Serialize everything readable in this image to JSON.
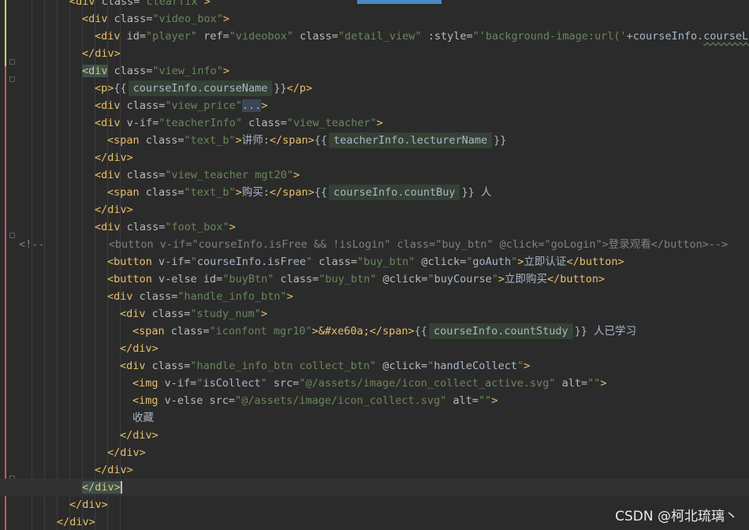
{
  "colors": {
    "background": "#2b2b2b",
    "tag": "#e8bf6a",
    "attribute": "#bababa",
    "string": "#6a8759",
    "text": "#a9b7c6",
    "comment": "#808080",
    "inlay_hint": "#344134"
  },
  "editor": {
    "lines": [
      {
        "tokens": [
          {
            "t": "tag",
            "v": "<div"
          },
          {
            "t": "attr",
            "v": " class="
          },
          {
            "t": "str",
            "v": "\"clearfix\""
          },
          {
            "t": "tag",
            "v": ">"
          }
        ]
      },
      {
        "tokens": [
          {
            "t": "tag",
            "v": "<div"
          },
          {
            "t": "attr",
            "v": " class="
          },
          {
            "t": "str",
            "v": "\"video_box\""
          },
          {
            "t": "tag",
            "v": ">"
          }
        ]
      },
      {
        "tokens": [
          {
            "t": "tag",
            "v": "<div"
          },
          {
            "t": "attr",
            "v": " id="
          },
          {
            "t": "str",
            "v": "\"player\""
          },
          {
            "t": "attr",
            "v": " ref="
          },
          {
            "t": "str",
            "v": "\"videobox\""
          },
          {
            "t": "attr",
            "v": " class="
          },
          {
            "t": "str",
            "v": "\"detail_view\""
          },
          {
            "t": "attr",
            "v": " :style="
          },
          {
            "t": "str",
            "v": "\"'background-image:url('"
          },
          {
            "t": "ex",
            "v": "+courseInfo."
          },
          {
            "t": "ex",
            "v": "courseLogo"
          }
        ]
      },
      {
        "tokens": [
          {
            "t": "tag",
            "v": "</div>"
          }
        ]
      },
      {
        "tokens": [
          {
            "t": "br",
            "v": "<div"
          },
          {
            "t": "attr",
            "v": " class="
          },
          {
            "t": "str",
            "v": "\"view_info\""
          },
          {
            "t": "tag",
            "v": ">"
          }
        ]
      },
      {
        "tokens": [
          {
            "t": "tag",
            "v": "<p>"
          },
          {
            "t": "txt",
            "v": "{{"
          },
          {
            "t": "chip",
            "v": "courseInfo.courseName"
          },
          {
            "t": "txt",
            "v": "}}"
          },
          {
            "t": "tag",
            "v": "</p>"
          }
        ]
      },
      {
        "tokens": [
          {
            "t": "tag",
            "v": "<div"
          },
          {
            "t": "attr",
            "v": " class="
          },
          {
            "t": "str",
            "v": "\"view_price\""
          },
          {
            "t": "folded",
            "v": "..."
          },
          {
            "t": "tag",
            "v": ">"
          }
        ]
      },
      {
        "tokens": [
          {
            "t": "tag",
            "v": "<div"
          },
          {
            "t": "attr",
            "v": " v-if="
          },
          {
            "t": "str",
            "v": "\"teacherInfo\""
          },
          {
            "t": "attr",
            "v": " class="
          },
          {
            "t": "str",
            "v": "\"view_teacher\""
          },
          {
            "t": "tag",
            "v": ">"
          }
        ]
      },
      {
        "tokens": [
          {
            "t": "tag",
            "v": "<span"
          },
          {
            "t": "attr",
            "v": " class="
          },
          {
            "t": "str",
            "v": "\"text_b\""
          },
          {
            "t": "tag",
            "v": ">"
          },
          {
            "t": "txt",
            "v": "讲师:"
          },
          {
            "t": "tag",
            "v": "</span>"
          },
          {
            "t": "txt",
            "v": "{{"
          },
          {
            "t": "chip",
            "v": "teacherInfo.lecturerName"
          },
          {
            "t": "txt",
            "v": "}}"
          }
        ]
      },
      {
        "tokens": [
          {
            "t": "tag",
            "v": "</div>"
          }
        ]
      },
      {
        "tokens": [
          {
            "t": "tag",
            "v": "<div"
          },
          {
            "t": "attr",
            "v": " class="
          },
          {
            "t": "str",
            "v": "\"view_teacher mgt20\""
          },
          {
            "t": "tag",
            "v": ">"
          }
        ]
      },
      {
        "tokens": [
          {
            "t": "tag",
            "v": "<span"
          },
          {
            "t": "attr",
            "v": " class="
          },
          {
            "t": "str",
            "v": "\"text_b\""
          },
          {
            "t": "tag",
            "v": ">"
          },
          {
            "t": "txt",
            "v": "购买:"
          },
          {
            "t": "tag",
            "v": "</span>"
          },
          {
            "t": "txt",
            "v": "{{"
          },
          {
            "t": "chip",
            "v": "courseInfo.countBuy"
          },
          {
            "t": "txt",
            "v": "}} 人"
          }
        ]
      },
      {
        "tokens": [
          {
            "t": "tag",
            "v": "</div>"
          }
        ]
      },
      {
        "tokens": [
          {
            "t": "tag",
            "v": "<div"
          },
          {
            "t": "attr",
            "v": " class="
          },
          {
            "t": "str",
            "v": "\"foot_box\""
          },
          {
            "t": "tag",
            "v": ">"
          }
        ]
      },
      {
        "tokens": [
          {
            "t": "cm",
            "v": "<!--          <button v-if=\"courseInfo.isFree && !isLogin\" class=\"buy_btn\" @click=\"goLogin\">登录观看</button>-->"
          }
        ]
      },
      {
        "tokens": [
          {
            "t": "tag",
            "v": "<button"
          },
          {
            "t": "attr",
            "v": " v-if="
          },
          {
            "t": "str",
            "v": "\""
          },
          {
            "t": "ex",
            "v": "courseInfo.isFree"
          },
          {
            "t": "str",
            "v": "\""
          },
          {
            "t": "attr",
            "v": " class="
          },
          {
            "t": "str",
            "v": "\"buy_btn\""
          },
          {
            "t": "attr",
            "v": " @click="
          },
          {
            "t": "str",
            "v": "\""
          },
          {
            "t": "ex",
            "v": "goAuth"
          },
          {
            "t": "str",
            "v": "\""
          },
          {
            "t": "tag",
            "v": ">"
          },
          {
            "t": "txt",
            "v": "立即认证"
          },
          {
            "t": "tag",
            "v": "</button>"
          }
        ]
      },
      {
        "tokens": [
          {
            "t": "tag",
            "v": "<button"
          },
          {
            "t": "attr",
            "v": " v-else id="
          },
          {
            "t": "str",
            "v": "\"buyBtn\""
          },
          {
            "t": "attr",
            "v": " class="
          },
          {
            "t": "str",
            "v": "\"buy_btn\""
          },
          {
            "t": "attr",
            "v": " @click="
          },
          {
            "t": "str",
            "v": "\""
          },
          {
            "t": "ex",
            "v": "buyCourse"
          },
          {
            "t": "str",
            "v": "\""
          },
          {
            "t": "tag",
            "v": ">"
          },
          {
            "t": "txt",
            "v": "立即购买"
          },
          {
            "t": "tag",
            "v": "</button>"
          }
        ]
      },
      {
        "tokens": [
          {
            "t": "tag",
            "v": "<div"
          },
          {
            "t": "attr",
            "v": " class="
          },
          {
            "t": "str",
            "v": "\"handle_info_btn\""
          },
          {
            "t": "tag",
            "v": ">"
          }
        ]
      },
      {
        "tokens": [
          {
            "t": "tag",
            "v": "<div"
          },
          {
            "t": "attr",
            "v": " class="
          },
          {
            "t": "str",
            "v": "\"study_num\""
          },
          {
            "t": "tag",
            "v": ">"
          }
        ]
      },
      {
        "tokens": [
          {
            "t": "tag",
            "v": "<span"
          },
          {
            "t": "attr",
            "v": " class="
          },
          {
            "t": "str",
            "v": "\"iconfont mgr10\""
          },
          {
            "t": "tag",
            "v": ">"
          },
          {
            "t": "tag",
            "v": "&#xe60a;"
          },
          {
            "t": "tag",
            "v": "</span>"
          },
          {
            "t": "txt",
            "v": "{{"
          },
          {
            "t": "chip",
            "v": "courseInfo.countStudy"
          },
          {
            "t": "txt",
            "v": "}} 人已学习"
          }
        ]
      },
      {
        "tokens": [
          {
            "t": "tag",
            "v": "</div>"
          }
        ]
      },
      {
        "tokens": [
          {
            "t": "tag",
            "v": "<div"
          },
          {
            "t": "attr",
            "v": " class="
          },
          {
            "t": "str",
            "v": "\"handle_info_btn collect_btn\""
          },
          {
            "t": "attr",
            "v": " @click="
          },
          {
            "t": "str",
            "v": "\""
          },
          {
            "t": "ex",
            "v": "handleCollect"
          },
          {
            "t": "str",
            "v": "\""
          },
          {
            "t": "tag",
            "v": ">"
          }
        ]
      },
      {
        "tokens": [
          {
            "t": "tag",
            "v": "<img"
          },
          {
            "t": "attr",
            "v": " v-if="
          },
          {
            "t": "str",
            "v": "\""
          },
          {
            "t": "ex",
            "v": "isCollect"
          },
          {
            "t": "str",
            "v": "\""
          },
          {
            "t": "attr",
            "v": " src="
          },
          {
            "t": "str",
            "v": "\"@/assets/image/icon_collect_active.svg\""
          },
          {
            "t": "attr",
            "v": " alt="
          },
          {
            "t": "str",
            "v": "\"\""
          },
          {
            "t": "tag",
            "v": ">"
          }
        ]
      },
      {
        "tokens": [
          {
            "t": "tag",
            "v": "<img"
          },
          {
            "t": "attr",
            "v": " v-else src="
          },
          {
            "t": "str",
            "v": "\"@/assets/image/icon_collect.svg\""
          },
          {
            "t": "attr",
            "v": " alt="
          },
          {
            "t": "str",
            "v": "\"\""
          },
          {
            "t": "tag",
            "v": ">"
          }
        ]
      },
      {
        "tokens": [
          {
            "t": "txt",
            "v": "收藏"
          }
        ]
      },
      {
        "tokens": [
          {
            "t": "tag",
            "v": "</div>"
          }
        ]
      },
      {
        "tokens": [
          {
            "t": "tag",
            "v": "</div>"
          }
        ]
      },
      {
        "tokens": [
          {
            "t": "tag",
            "v": "</div>"
          }
        ]
      },
      {
        "tokens": [
          {
            "t": "br",
            "v": "</div>"
          }
        ]
      },
      {
        "tokens": [
          {
            "t": "tag",
            "v": "</div>"
          }
        ]
      },
      {
        "tokens": [
          {
            "t": "tag",
            "v": "</div>"
          }
        ]
      }
    ]
  },
  "watermark": "CSDN @柯北琉璃丶"
}
